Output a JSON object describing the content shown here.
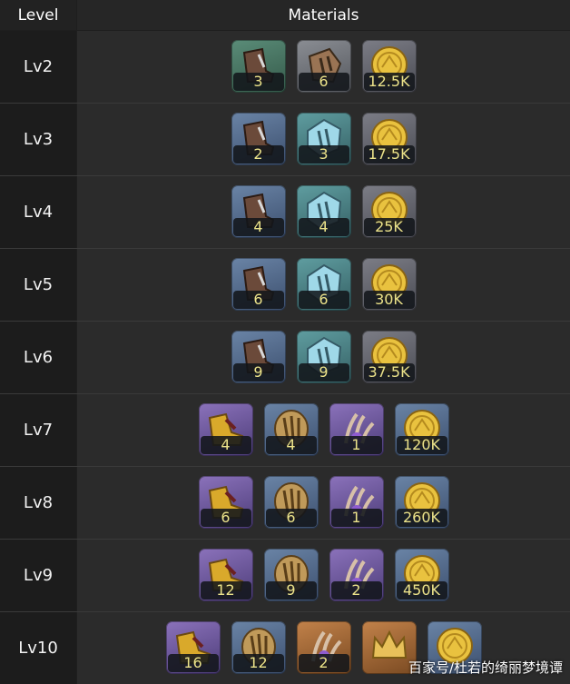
{
  "header": {
    "level": "Level",
    "materials": "Materials"
  },
  "rows": [
    {
      "level": "Lv2",
      "items": [
        {
          "icon": "boot-icon",
          "bg": "green",
          "qty": "3"
        },
        {
          "icon": "ore-icon",
          "bg": "gray",
          "qty": "6"
        },
        {
          "icon": "gold-coin-icon",
          "bg": "gold",
          "qty": "12.5K"
        }
      ]
    },
    {
      "level": "Lv3",
      "items": [
        {
          "icon": "boot-icon",
          "bg": "blue",
          "qty": "2"
        },
        {
          "icon": "crystal-ore-icon",
          "bg": "teal",
          "qty": "3"
        },
        {
          "icon": "gold-coin-icon",
          "bg": "gold",
          "qty": "17.5K"
        }
      ]
    },
    {
      "level": "Lv4",
      "items": [
        {
          "icon": "boot-icon",
          "bg": "blue",
          "qty": "4"
        },
        {
          "icon": "crystal-ore-icon",
          "bg": "teal",
          "qty": "4"
        },
        {
          "icon": "gold-coin-icon",
          "bg": "gold",
          "qty": "25K"
        }
      ]
    },
    {
      "level": "Lv5",
      "items": [
        {
          "icon": "boot-icon",
          "bg": "blue",
          "qty": "6"
        },
        {
          "icon": "crystal-ore-icon",
          "bg": "teal",
          "qty": "6"
        },
        {
          "icon": "gold-coin-icon",
          "bg": "gold",
          "qty": "30K"
        }
      ]
    },
    {
      "level": "Lv6",
      "items": [
        {
          "icon": "boot-icon",
          "bg": "blue",
          "qty": "9"
        },
        {
          "icon": "crystal-ore-icon",
          "bg": "teal",
          "qty": "9"
        },
        {
          "icon": "gold-coin-icon",
          "bg": "gold",
          "qty": "37.5K"
        }
      ]
    },
    {
      "level": "Lv7",
      "items": [
        {
          "icon": "gold-boot-icon",
          "bg": "purple",
          "qty": "4"
        },
        {
          "icon": "bronze-ore-icon",
          "bg": "blue",
          "qty": "4"
        },
        {
          "icon": "claw-icon",
          "bg": "purple",
          "qty": "1"
        },
        {
          "icon": "gold-coin-icon",
          "bg": "blue",
          "qty": "120K"
        }
      ]
    },
    {
      "level": "Lv8",
      "items": [
        {
          "icon": "gold-boot-icon",
          "bg": "purple",
          "qty": "6"
        },
        {
          "icon": "bronze-ore-icon",
          "bg": "blue",
          "qty": "6"
        },
        {
          "icon": "claw-icon",
          "bg": "purple",
          "qty": "1"
        },
        {
          "icon": "gold-coin-icon",
          "bg": "blue",
          "qty": "260K"
        }
      ]
    },
    {
      "level": "Lv9",
      "items": [
        {
          "icon": "gold-boot-icon",
          "bg": "purple",
          "qty": "12"
        },
        {
          "icon": "bronze-ore-icon",
          "bg": "blue",
          "qty": "9"
        },
        {
          "icon": "claw-icon",
          "bg": "purple",
          "qty": "2"
        },
        {
          "icon": "gold-coin-icon",
          "bg": "blue",
          "qty": "450K"
        }
      ]
    },
    {
      "level": "Lv10",
      "items": [
        {
          "icon": "gold-boot-icon",
          "bg": "purple",
          "qty": "16"
        },
        {
          "icon": "bronze-ore-icon",
          "bg": "blue",
          "qty": "12"
        },
        {
          "icon": "claw-icon",
          "bg": "orange",
          "qty": "2"
        },
        {
          "icon": "crown-icon",
          "bg": "orange",
          "qty": ""
        },
        {
          "icon": "gold-coin-icon",
          "bg": "blue",
          "qty": ""
        }
      ]
    }
  ],
  "watermark": "百家号/杜若的绮丽梦境谭",
  "colors": {
    "quantity_text": "#ece38a",
    "level_bg": "#1c1c1c",
    "materials_bg": "#2b2b2b"
  }
}
